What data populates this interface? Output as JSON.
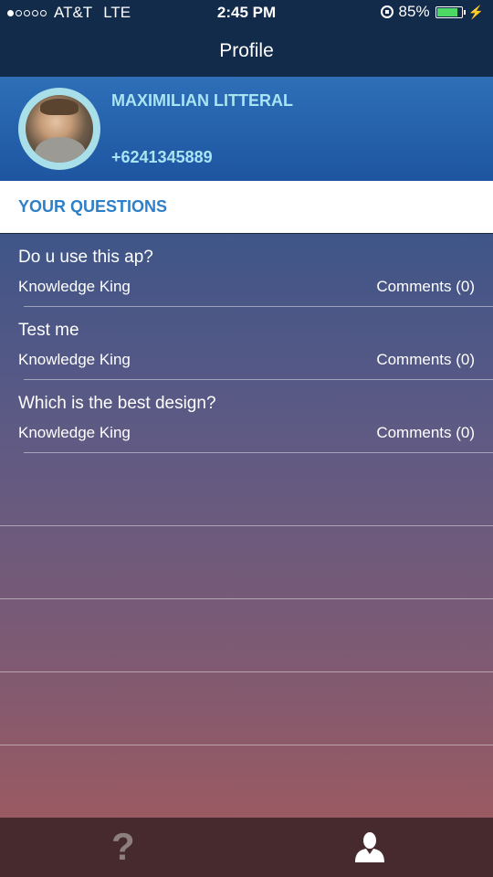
{
  "status_bar": {
    "carrier": "AT&T",
    "network": "LTE",
    "time": "2:45 PM",
    "battery": "85%",
    "battery_level": 0.85,
    "signal_bars_filled": 1,
    "signal_bars_total": 5
  },
  "nav": {
    "title": "Profile"
  },
  "profile": {
    "name": "MAXIMILIAN LITTERAL",
    "phone": "+6241345889"
  },
  "section": {
    "title": "YOUR QUESTIONS"
  },
  "questions": [
    {
      "title": "Do u use this ap?",
      "author": "Knowledge King",
      "comments": "Comments (0)"
    },
    {
      "title": "Test me",
      "author": "Knowledge King",
      "comments": "Comments (0)"
    },
    {
      "title": "Which is the best design?",
      "author": "Knowledge King",
      "comments": "Comments (0)"
    }
  ],
  "tabs": [
    {
      "id": "questions",
      "icon": "question-icon",
      "active": false
    },
    {
      "id": "profile",
      "icon": "profile-icon",
      "active": true
    }
  ],
  "colors": {
    "nav_background": "#132b4a",
    "profile_background": "#2363ab",
    "profile_text": "#a9e4f2",
    "section_title": "#2d7fc7",
    "tab_bar": "#462a2d",
    "tab_inactive": "#8d7f80",
    "tab_active": "#ffffff"
  }
}
